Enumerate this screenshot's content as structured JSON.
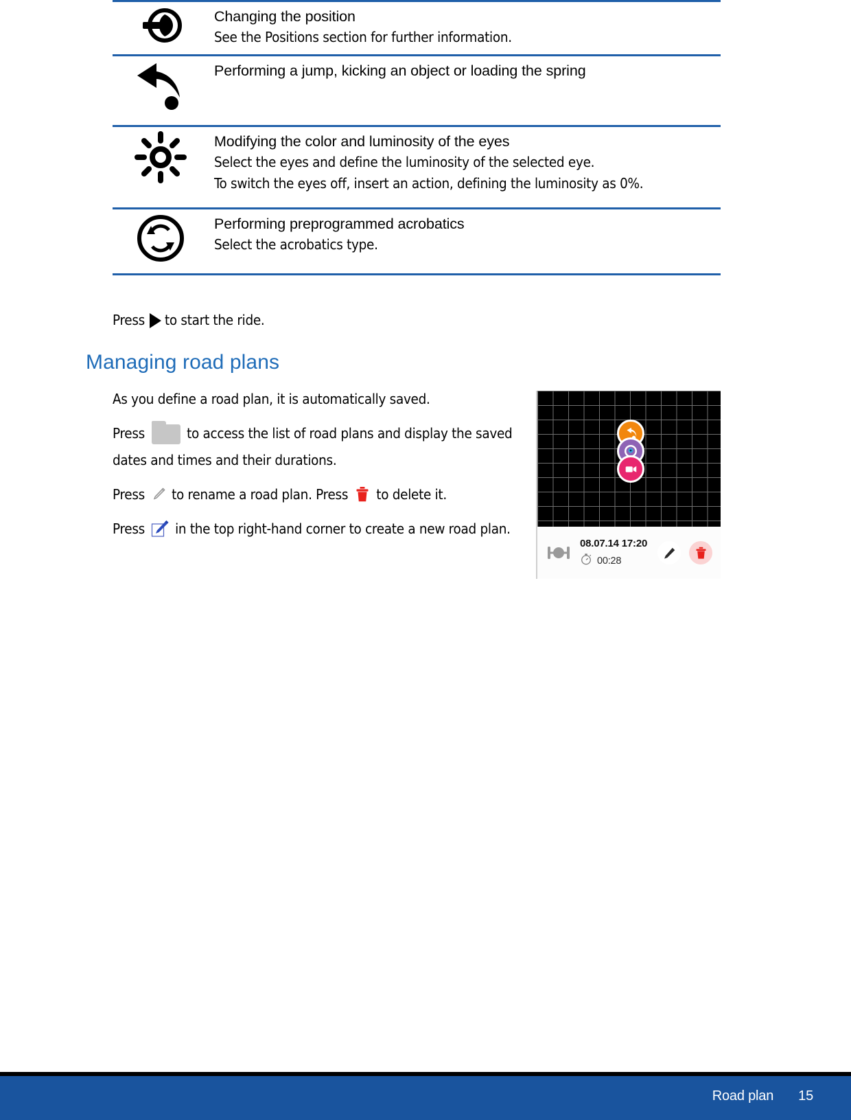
{
  "table": {
    "rows": [
      {
        "icon": "target-position-icon",
        "title": "Changing the position",
        "lines": [
          "See the Positions section for further information."
        ]
      },
      {
        "icon": "jump-arrow-icon",
        "title": "Performing a jump, kicking an object or loading the spring",
        "lines": []
      },
      {
        "icon": "brightness-sun-icon",
        "title": "Modifying the color and luminosity of the eyes",
        "lines": [
          "Select the eyes and define the luminosity of the selected eye.",
          "To switch the eyes off, insert an action, defining the luminosity as 0%."
        ]
      },
      {
        "icon": "acrobatics-refresh-icon",
        "title": "Performing preprogrammed acrobatics",
        "lines": [
          "Select the acrobatics type."
        ]
      }
    ]
  },
  "press_play": {
    "before": "Press",
    "after": "to start the ride."
  },
  "section": {
    "heading": "Managing road plans"
  },
  "body": {
    "p1": "As you define a road plan, it is automatically saved.",
    "p2_before": "Press",
    "p2_after": "to access the list of road plans and display the saved dates and times and their durations.",
    "p3_before": "Press",
    "p3_mid": "to rename a road plan. Press",
    "p3_after": "to delete it.",
    "p4_before": "Press",
    "p4_after": "in the top right-hand corner to create a new road plan."
  },
  "screenshot": {
    "date": "08.07.14 17:20",
    "duration": "00:28",
    "thumb_icon": "robot-thumbnail-icon",
    "timer_icon": "stopwatch-icon",
    "edit_icon": "pencil-icon",
    "delete_icon": "trash-icon",
    "tokens": [
      {
        "name": "jump-action-token",
        "color": "#f2870d"
      },
      {
        "name": "acrobatics-action-token",
        "color": "#8e63b5"
      },
      {
        "name": "eyes-action-token",
        "color": "#e8266e"
      }
    ]
  },
  "footer": {
    "chapter": "Road plan",
    "page": "15"
  },
  "colors": {
    "rule_blue": "#1f5fa9",
    "heading_blue": "#1f6cb8",
    "footer_blue": "#19549e",
    "delete_red": "#e8211c"
  }
}
